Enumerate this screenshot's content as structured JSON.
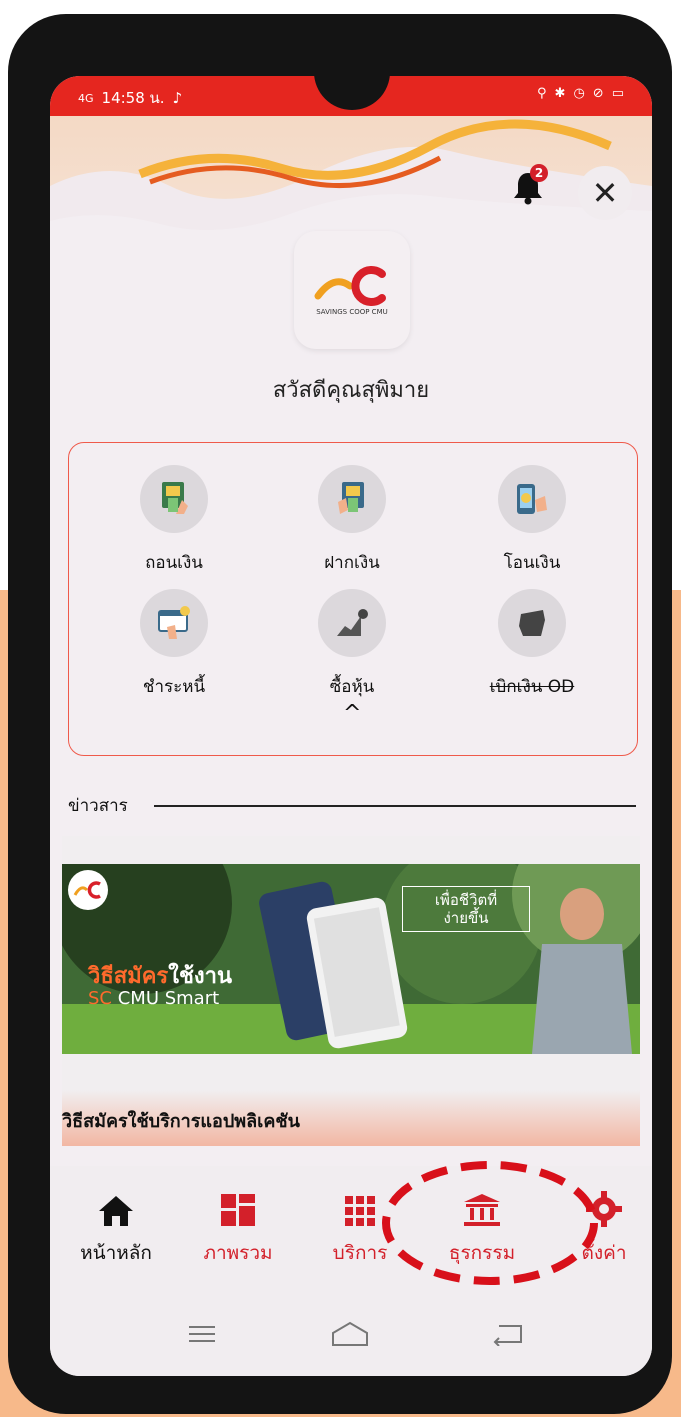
{
  "status_bar": {
    "signal": "4G",
    "time": "14:58 น.",
    "app_icon": "tiktok-icon",
    "right_icons": [
      "location-icon",
      "bluetooth-icon",
      "alarm-icon",
      "mute-icon",
      "volte-icon",
      "battery-icon"
    ]
  },
  "header": {
    "notification_count": "2",
    "close_symbol": "✕"
  },
  "logo": {
    "small_text": "SAVINGS COOP CMU"
  },
  "greeting": "สวัสดีคุณสุพิมาย",
  "menu": {
    "items": [
      {
        "label": "ถอนเงิน",
        "icon": "atm-withdraw-icon"
      },
      {
        "label": "ฝากเงิน",
        "icon": "atm-deposit-icon"
      },
      {
        "label": "โอนเงิน",
        "icon": "phone-transfer-icon"
      },
      {
        "label": "ชำระหนี้",
        "icon": "bill-payment-icon"
      },
      {
        "label": "ซื้อหุ้น",
        "icon": "stock-chart-icon"
      },
      {
        "label": "เบิกเงิน OD",
        "icon": "money-bag-icon"
      }
    ],
    "collapse_symbol": "^"
  },
  "news": {
    "section_title": "ข่าวสาร",
    "banner_title_orange": "วิธีสมัคร",
    "banner_title_white": "ใช้งาน",
    "banner_sub_orange": "SC",
    "banner_sub_white": " CMU Smart",
    "banner_tag_line1": "เพื่อชีวิตที่",
    "banner_tag_line2": "ง่ายขึ้น",
    "caption": "วิธีสมัครใช้บริการแอปพลิเคชัน"
  },
  "bottom_nav": {
    "items": [
      {
        "label": "หน้าหลัก",
        "icon": "home-icon"
      },
      {
        "label": "ภาพรวม",
        "icon": "dashboard-icon"
      },
      {
        "label": "บริการ",
        "icon": "grid-icon"
      },
      {
        "label": "ธุรกรรม",
        "icon": "bank-icon"
      },
      {
        "label": "ตั้งค่า",
        "icon": "gear-icon"
      }
    ]
  },
  "colors": {
    "accent_red": "#e5261f",
    "text_red": "#d3202a",
    "annotation_red": "#d8101a",
    "page_orange": "#f7b98a"
  }
}
